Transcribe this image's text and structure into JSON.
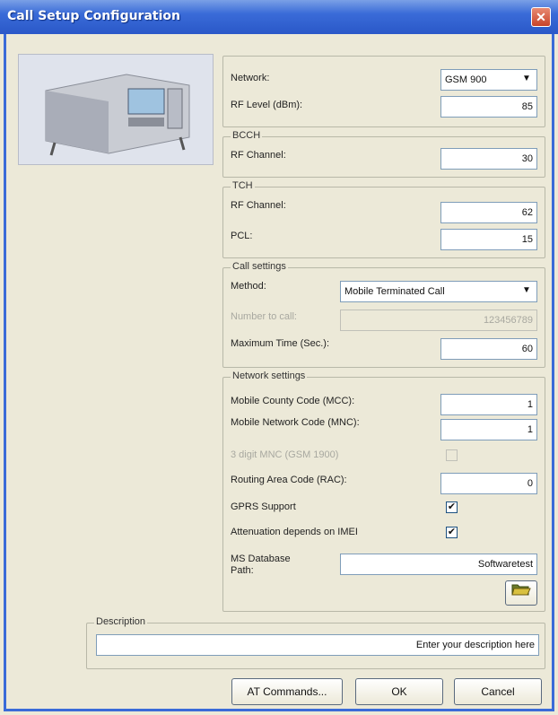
{
  "window": {
    "title": "Call Setup Configuration",
    "close_glyph": "✕"
  },
  "device_image": {
    "icon": "test-device-image"
  },
  "general": {
    "network_label": "Network:",
    "network_value": "GSM 900",
    "rf_level_label": "RF Level (dBm):",
    "rf_level_value": "85"
  },
  "bcch": {
    "legend": "BCCH",
    "rf_channel_label": "RF Channel:",
    "rf_channel_value": "30"
  },
  "tch": {
    "legend": "TCH",
    "rf_channel_label": "RF Channel:",
    "rf_channel_value": "62",
    "pcl_label": "PCL:",
    "pcl_value": "15"
  },
  "call_settings": {
    "legend": "Call settings",
    "method_label": "Method:",
    "method_value": "Mobile Terminated Call",
    "number_label": "Number to call:",
    "number_value": "123456789",
    "max_time_label": "Maximum Time (Sec.):",
    "max_time_value": "60"
  },
  "network_settings": {
    "legend": "Network settings",
    "mcc_label": "Mobile County Code (MCC):",
    "mcc_value": "1",
    "mnc_label": "Mobile Network Code (MNC):",
    "mnc_value": "1",
    "mnc3_label": "3 digit MNC (GSM 1900)",
    "rac_label": "Routing Area Code (RAC):",
    "rac_value": "0",
    "gprs_label": "GPRS Support",
    "gprs_checked": "✔",
    "attenuation_label": "Attenuation depends on IMEI",
    "attenuation_checked": "✔",
    "db_path_label": "MS Database Path:",
    "db_path_value": "Softwaretest"
  },
  "description": {
    "legend": "Description",
    "value": "Enter your description here"
  },
  "buttons": {
    "at_commands": "AT Commands...",
    "ok": "OK",
    "cancel": "Cancel"
  },
  "icons": {
    "dropdown_arrow": "▼",
    "folder": "folder-open-icon"
  }
}
